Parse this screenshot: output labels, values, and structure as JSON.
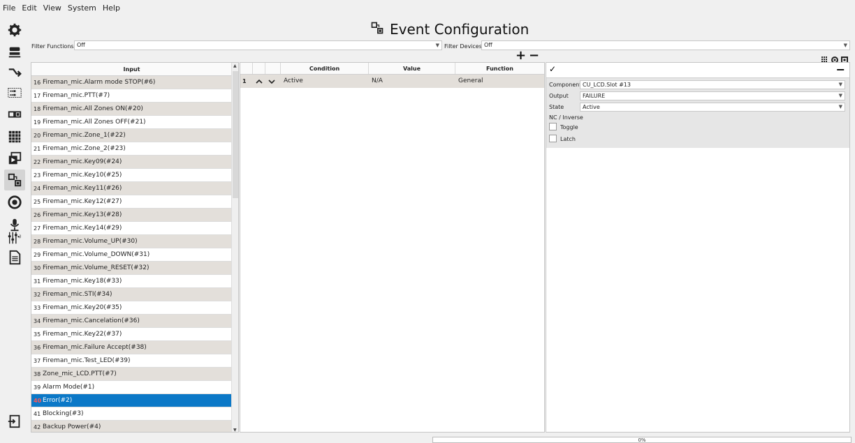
{
  "menu": [
    "File",
    "Edit",
    "View",
    "System",
    "Help"
  ],
  "title": "Event Configuration",
  "filters": {
    "functions_label": "Filter Functions:",
    "functions_value": "Off",
    "devices_label": "Filter Devices:",
    "devices_value": "Off"
  },
  "toolbar_icons": [
    "gear-icon",
    "server-icon",
    "route-arrow-icon",
    "audio-matrix-icon",
    "device-pair-icon",
    "grid-icon",
    "window-play-icon",
    "event-config-icon",
    "help-circle-icon",
    "microphone-settings-icon",
    "mixer-icon",
    "document-icon",
    "exit-icon"
  ],
  "input_table": {
    "header": "Input",
    "rows": [
      {
        "num": "16",
        "label": "Fireman_mic.Alarm mode STOP(#6)"
      },
      {
        "num": "17",
        "label": "Fireman_mic.PTT(#7)"
      },
      {
        "num": "18",
        "label": "Fireman_mic.All Zones ON(#20)"
      },
      {
        "num": "19",
        "label": "Fireman_mic.All Zones OFF(#21)"
      },
      {
        "num": "20",
        "label": "Fireman_mic.Zone_1(#22)"
      },
      {
        "num": "21",
        "label": "Fireman_mic.Zone_2(#23)"
      },
      {
        "num": "22",
        "label": "Fireman_mic.Key09(#24)"
      },
      {
        "num": "23",
        "label": "Fireman_mic.Key10(#25)"
      },
      {
        "num": "24",
        "label": "Fireman_mic.Key11(#26)"
      },
      {
        "num": "25",
        "label": "Fireman_mic.Key12(#27)"
      },
      {
        "num": "26",
        "label": "Fireman_mic.Key13(#28)"
      },
      {
        "num": "27",
        "label": "Fireman_mic.Key14(#29)"
      },
      {
        "num": "28",
        "label": "Fireman_mic.Volume_UP(#30)"
      },
      {
        "num": "29",
        "label": "Fireman_mic.Volume_DOWN(#31)"
      },
      {
        "num": "30",
        "label": "Fireman_mic.Volume_RESET(#32)"
      },
      {
        "num": "31",
        "label": "Fireman_mic.Key18(#33)"
      },
      {
        "num": "32",
        "label": "Fireman_mic.STI(#34)"
      },
      {
        "num": "33",
        "label": "Fireman_mic.Key20(#35)"
      },
      {
        "num": "34",
        "label": "Fireman_mic.Cancelation(#36)"
      },
      {
        "num": "35",
        "label": "Fireman_mic.Key22(#37)"
      },
      {
        "num": "36",
        "label": "Fireman_mic.Failure Accept(#38)"
      },
      {
        "num": "37",
        "label": "Fireman_mic.Test_LED(#39)"
      },
      {
        "num": "38",
        "label": "Zone_mic_LCD.PTT(#7)"
      },
      {
        "num": "39",
        "label": "Alarm Mode(#1)"
      },
      {
        "num": "40",
        "label": "Error(#2)"
      },
      {
        "num": "41",
        "label": "Blocking(#3)"
      },
      {
        "num": "42",
        "label": "Backup Power(#4)"
      }
    ],
    "selected_row": "40"
  },
  "event_table": {
    "headers": {
      "condition": "Condition",
      "value": "Value",
      "function": "Function"
    },
    "row": {
      "num": "1",
      "condition": "Active",
      "value": "N/A",
      "function": "General"
    }
  },
  "config": {
    "component_label": "Component",
    "component_value": "CU_LCD.Slot #13",
    "output_label": "Output",
    "output_value": "FAILURE",
    "state_label": "State",
    "state_value": "Active",
    "nc_label": "NC / Inverse",
    "toggle_label": "Toggle",
    "latch_label": "Latch",
    "toggle_checked": false,
    "latch_checked": false
  },
  "progress_text": "0%"
}
